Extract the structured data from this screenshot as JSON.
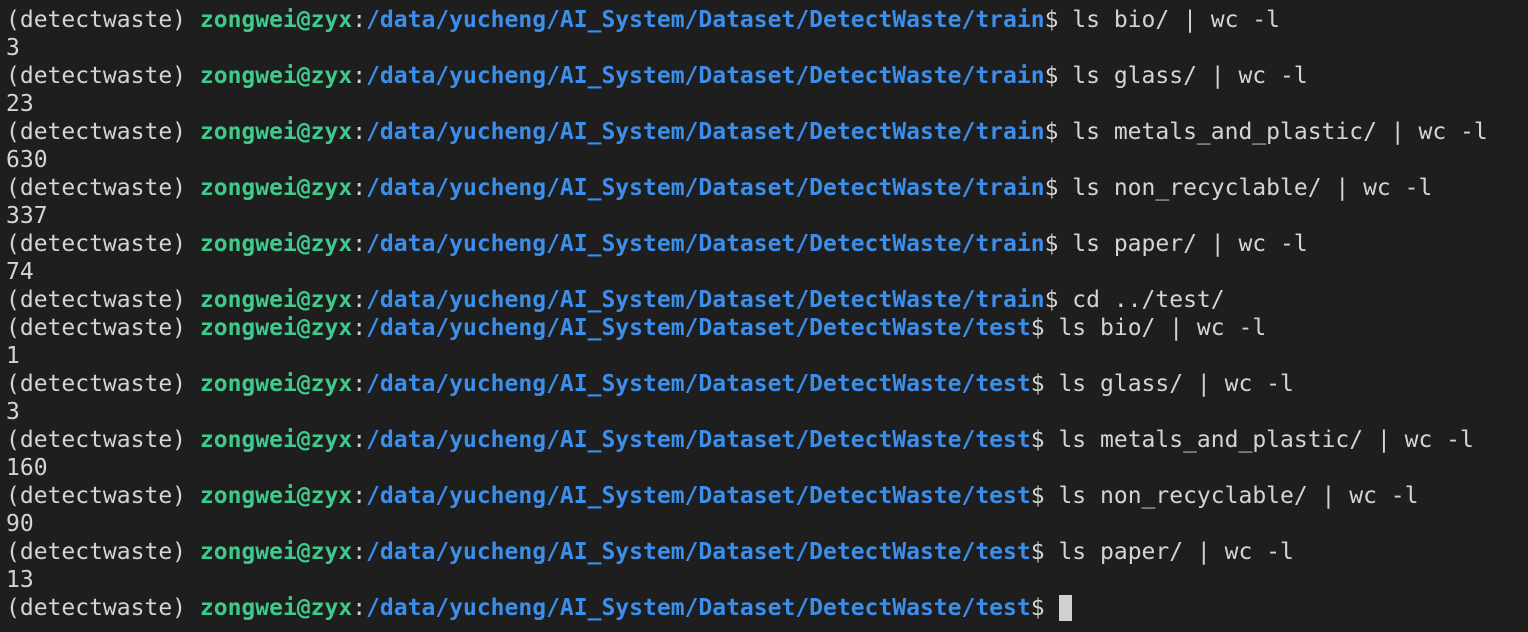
{
  "terminal": {
    "lines": [
      {
        "env": "(detectwaste)",
        "user": "zongwei@zyx",
        "path": "/data/yucheng/AI_System/Dataset/DetectWaste/train",
        "cmd": "ls bio/ | wc -l"
      },
      {
        "output": "3"
      },
      {
        "env": "(detectwaste)",
        "user": "zongwei@zyx",
        "path": "/data/yucheng/AI_System/Dataset/DetectWaste/train",
        "cmd": "ls glass/ | wc -l"
      },
      {
        "output": "23"
      },
      {
        "env": "(detectwaste)",
        "user": "zongwei@zyx",
        "path": "/data/yucheng/AI_System/Dataset/DetectWaste/train",
        "cmd": "ls metals_and_plastic/ | wc -l"
      },
      {
        "output": "630"
      },
      {
        "env": "(detectwaste)",
        "user": "zongwei@zyx",
        "path": "/data/yucheng/AI_System/Dataset/DetectWaste/train",
        "cmd": "ls non_recyclable/ | wc -l"
      },
      {
        "output": "337"
      },
      {
        "env": "(detectwaste)",
        "user": "zongwei@zyx",
        "path": "/data/yucheng/AI_System/Dataset/DetectWaste/train",
        "cmd": "ls paper/ | wc -l"
      },
      {
        "output": "74"
      },
      {
        "env": "(detectwaste)",
        "user": "zongwei@zyx",
        "path": "/data/yucheng/AI_System/Dataset/DetectWaste/train",
        "cmd": "cd ../test/"
      },
      {
        "env": "(detectwaste)",
        "user": "zongwei@zyx",
        "path": "/data/yucheng/AI_System/Dataset/DetectWaste/test",
        "cmd": "ls bio/ | wc -l"
      },
      {
        "output": "1"
      },
      {
        "env": "(detectwaste)",
        "user": "zongwei@zyx",
        "path": "/data/yucheng/AI_System/Dataset/DetectWaste/test",
        "cmd": "ls glass/ | wc -l"
      },
      {
        "output": "3"
      },
      {
        "env": "(detectwaste)",
        "user": "zongwei@zyx",
        "path": "/data/yucheng/AI_System/Dataset/DetectWaste/test",
        "cmd": "ls metals_and_plastic/ | wc -l"
      },
      {
        "output": "160"
      },
      {
        "env": "(detectwaste)",
        "user": "zongwei@zyx",
        "path": "/data/yucheng/AI_System/Dataset/DetectWaste/test",
        "cmd": "ls non_recyclable/ | wc -l"
      },
      {
        "output": "90"
      },
      {
        "env": "(detectwaste)",
        "user": "zongwei@zyx",
        "path": "/data/yucheng/AI_System/Dataset/DetectWaste/test",
        "cmd": "ls paper/ | wc -l"
      },
      {
        "output": "13"
      },
      {
        "env": "(detectwaste)",
        "user": "zongwei@zyx",
        "path": "/data/yucheng/AI_System/Dataset/DetectWaste/test",
        "cmd": "",
        "cursor": true
      }
    ],
    "colors": {
      "background": "#1e1e1e",
      "foreground": "#d4d4d4",
      "user": "#3fc98a",
      "path": "#3b8eea",
      "cursor": "#d0d0d0"
    }
  }
}
